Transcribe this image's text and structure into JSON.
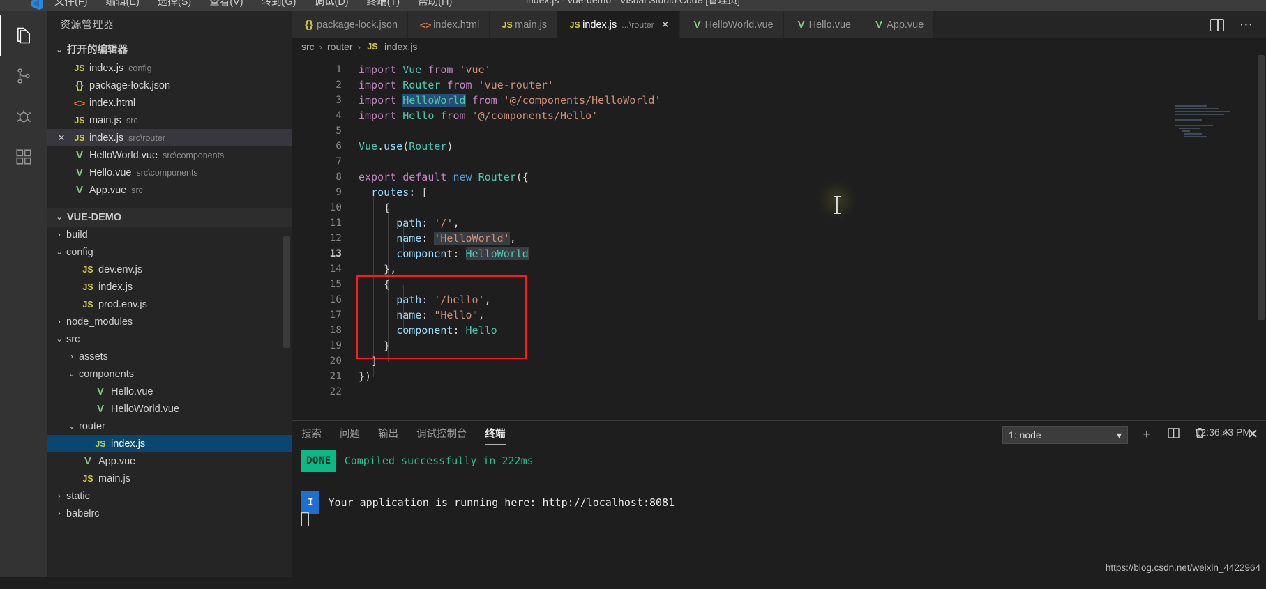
{
  "window": {
    "title": "index.js - vue-demo - Visual Studio Code [管理员]",
    "menu": [
      "文件(F)",
      "编辑(E)",
      "选择(S)",
      "查看(V)",
      "转到(G)",
      "调试(D)",
      "终端(T)",
      "帮助(H)"
    ]
  },
  "activitybar": {
    "items": [
      {
        "name": "explorer-icon",
        "glyph": "files"
      },
      {
        "name": "source-control-icon",
        "glyph": "branch"
      },
      {
        "name": "debug-icon",
        "glyph": "bug"
      },
      {
        "name": "extensions-icon",
        "glyph": "blocks"
      }
    ]
  },
  "sidebar": {
    "title": "资源管理器",
    "open_editors": {
      "header": "打开的编辑器",
      "items": [
        {
          "icon": "js-file-icon",
          "name": "index.js",
          "path": "config",
          "selected": false,
          "dirty": false
        },
        {
          "icon": "json-file-icon",
          "name": "package-lock.json",
          "path": "",
          "selected": false,
          "dirty": false
        },
        {
          "icon": "html-file-icon",
          "name": "index.html",
          "path": "",
          "selected": false,
          "dirty": false
        },
        {
          "icon": "js-file-icon",
          "name": "main.js",
          "path": "src",
          "selected": false,
          "dirty": false
        },
        {
          "icon": "js-file-icon",
          "name": "index.js",
          "path": "src\\router",
          "selected": true,
          "dirty": false
        },
        {
          "icon": "vue-file-icon",
          "name": "HelloWorld.vue",
          "path": "src\\components",
          "selected": false,
          "dirty": false
        },
        {
          "icon": "vue-file-icon",
          "name": "Hello.vue",
          "path": "src\\components",
          "selected": false,
          "dirty": false
        },
        {
          "icon": "vue-file-icon",
          "name": "App.vue",
          "path": "src",
          "selected": false,
          "dirty": false
        }
      ]
    },
    "project": {
      "header": "VUE-DEMO",
      "tree": [
        {
          "label": "build",
          "icon": "folder",
          "state": "collapsed",
          "depth": 1,
          "selected": false
        },
        {
          "label": "config",
          "icon": "folder",
          "state": "expanded",
          "depth": 1,
          "selected": false
        },
        {
          "label": "dev.env.js",
          "icon": "js-file-icon",
          "state": "file",
          "depth": 2,
          "selected": false
        },
        {
          "label": "index.js",
          "icon": "js-file-icon",
          "state": "file",
          "depth": 2,
          "selected": false
        },
        {
          "label": "prod.env.js",
          "icon": "js-file-icon",
          "state": "file",
          "depth": 2,
          "selected": false
        },
        {
          "label": "node_modules",
          "icon": "folder",
          "state": "collapsed",
          "depth": 1,
          "selected": false
        },
        {
          "label": "src",
          "icon": "folder",
          "state": "expanded",
          "depth": 1,
          "selected": false
        },
        {
          "label": "assets",
          "icon": "folder",
          "state": "collapsed",
          "depth": 2,
          "selected": false
        },
        {
          "label": "components",
          "icon": "folder",
          "state": "expanded",
          "depth": 2,
          "selected": false
        },
        {
          "label": "Hello.vue",
          "icon": "vue-file-icon",
          "state": "file",
          "depth": 3,
          "selected": false
        },
        {
          "label": "HelloWorld.vue",
          "icon": "vue-file-icon",
          "state": "file",
          "depth": 3,
          "selected": false
        },
        {
          "label": "router",
          "icon": "folder",
          "state": "expanded",
          "depth": 2,
          "selected": false
        },
        {
          "label": "index.js",
          "icon": "js-file-icon",
          "state": "file",
          "depth": 3,
          "selected": true
        },
        {
          "label": "App.vue",
          "icon": "vue-file-icon",
          "state": "file",
          "depth": 2,
          "selected": false
        },
        {
          "label": "main.js",
          "icon": "js-file-icon",
          "state": "file",
          "depth": 2,
          "selected": false
        },
        {
          "label": "static",
          "icon": "folder",
          "state": "collapsed",
          "depth": 1,
          "selected": false
        },
        {
          "label": "babelrc",
          "icon": "folder",
          "state": "collapsed",
          "depth": 1,
          "selected": false
        }
      ]
    }
  },
  "editor": {
    "tabs": [
      {
        "icon": "json-file-icon",
        "label": "package-lock.json",
        "sub": "",
        "active": false,
        "closable": false
      },
      {
        "icon": "html-file-icon",
        "label": "index.html",
        "sub": "",
        "active": false,
        "closable": false
      },
      {
        "icon": "js-file-icon",
        "label": "main.js",
        "sub": "",
        "active": false,
        "closable": false
      },
      {
        "icon": "js-file-icon",
        "label": "index.js",
        "sub": "...\\router",
        "active": true,
        "closable": true
      },
      {
        "icon": "vue-file-icon",
        "label": "HelloWorld.vue",
        "sub": "",
        "active": false,
        "closable": false
      },
      {
        "icon": "vue-file-icon",
        "label": "Hello.vue",
        "sub": "",
        "active": false,
        "closable": false
      },
      {
        "icon": "vue-file-icon",
        "label": "App.vue",
        "sub": "",
        "active": false,
        "closable": false
      }
    ],
    "actions": [
      {
        "name": "split-editor-button",
        "label": "split"
      },
      {
        "name": "more-actions-button",
        "label": "⋯"
      }
    ],
    "breadcrumb": [
      "src",
      "router",
      "index.js"
    ],
    "breadcrumb_file_icon": "js-file-icon",
    "code_lines": [
      {
        "n": 1,
        "text": "import Vue from 'vue'"
      },
      {
        "n": 2,
        "text": "import Router from 'vue-router'"
      },
      {
        "n": 3,
        "text": "import HelloWorld from '@/components/HelloWorld'"
      },
      {
        "n": 4,
        "text": "import Hello from '@/components/Hello'"
      },
      {
        "n": 5,
        "text": ""
      },
      {
        "n": 6,
        "text": "Vue.use(Router)"
      },
      {
        "n": 7,
        "text": ""
      },
      {
        "n": 8,
        "text": "export default new Router({"
      },
      {
        "n": 9,
        "text": "  routes: ["
      },
      {
        "n": 10,
        "text": "    {"
      },
      {
        "n": 11,
        "text": "      path: '/',"
      },
      {
        "n": 12,
        "text": "      name: 'HelloWorld',"
      },
      {
        "n": 13,
        "text": "      component: HelloWorld"
      },
      {
        "n": 14,
        "text": "    },"
      },
      {
        "n": 15,
        "text": "    {"
      },
      {
        "n": 16,
        "text": "      path: '/hello',"
      },
      {
        "n": 17,
        "text": "      name: \"Hello\","
      },
      {
        "n": 18,
        "text": "      component: Hello"
      },
      {
        "n": 19,
        "text": "    }"
      },
      {
        "n": 20,
        "text": "  ]"
      },
      {
        "n": 21,
        "text": "})"
      },
      {
        "n": 22,
        "text": ""
      }
    ],
    "current_line": 13,
    "annotation": {
      "name": "red-highlight-box",
      "from_line": 15,
      "to_line": 19,
      "color": "#ff1a1a"
    }
  },
  "panel": {
    "tabs": [
      {
        "label": "搜索",
        "active": false
      },
      {
        "label": "问题",
        "active": false
      },
      {
        "label": "输出",
        "active": false
      },
      {
        "label": "调试控制台",
        "active": false
      },
      {
        "label": "终端",
        "active": true
      }
    ],
    "terminal_select": {
      "value": "1: node",
      "chevron": "▾"
    },
    "actions": [
      {
        "name": "new-terminal-button",
        "glyph": "+"
      },
      {
        "name": "split-terminal-button",
        "glyph": "split"
      },
      {
        "name": "kill-terminal-button",
        "glyph": "trash"
      },
      {
        "name": "maximize-panel-button",
        "glyph": "^"
      },
      {
        "name": "close-panel-button",
        "glyph": "✕"
      }
    ],
    "output": [
      {
        "badge": "DONE",
        "badge_style": "done",
        "text": "Compiled successfully in 222ms",
        "text_style": "green"
      },
      {
        "badge": "",
        "badge_style": "",
        "text": "",
        "text_style": ""
      },
      {
        "badge": "I",
        "badge_style": "info",
        "text": "Your application is running here: http://localhost:8081",
        "text_style": "white"
      }
    ],
    "timestamp": "12:36:43 PM"
  },
  "watermark": "https://blog.csdn.net/weixin_4422964"
}
